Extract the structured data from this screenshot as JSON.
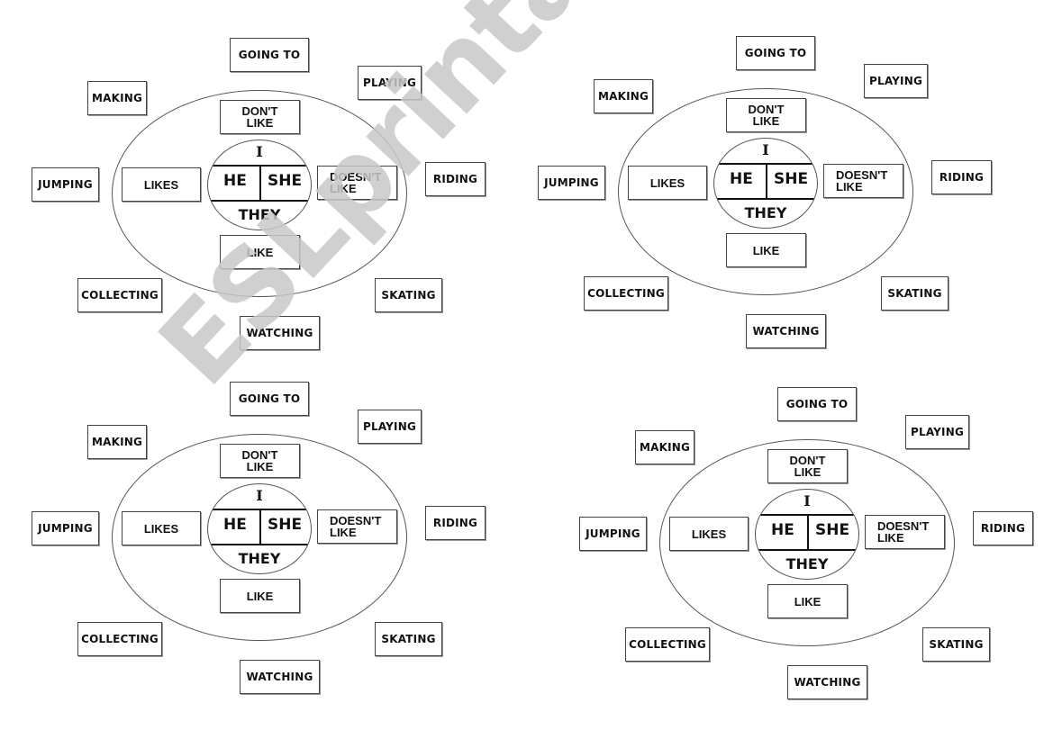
{
  "worksheet": {
    "diagrams": [
      {
        "pronouns": {
          "top": "I",
          "left": "HE",
          "right": "SHE",
          "bottom": "THEY"
        },
        "aux": {
          "dont_like": "DON'T\nLIKE",
          "likes": "LIKES",
          "doesnt_like": "DOESN'T\nLIKE",
          "like": "LIKE"
        },
        "verbs": {
          "going_to": "GOING TO",
          "playing": "PLAYING",
          "making": "MAKING",
          "jumping": "JUMPING",
          "riding": "RIDING",
          "collecting": "COLLECTING",
          "skating": "SKATING",
          "watching": "WATCHING"
        }
      },
      {
        "pronouns": {
          "top": "I",
          "left": "HE",
          "right": "SHE",
          "bottom": "THEY"
        },
        "aux": {
          "dont_like": "DON'T\nLIKE",
          "likes": "LIKES",
          "doesnt_like": "DOESN'T\nLIKE",
          "like": "LIKE"
        },
        "verbs": {
          "going_to": "GOING TO",
          "playing": "PLAYING",
          "making": "MAKING",
          "jumping": "JUMPING",
          "riding": "RIDING",
          "collecting": "COLLECTING",
          "skating": "SKATING",
          "watching": "WATCHING"
        }
      },
      {
        "pronouns": {
          "top": "I",
          "left": "HE",
          "right": "SHE",
          "bottom": "THEY"
        },
        "aux": {
          "dont_like": "DON'T\nLIKE",
          "likes": "LIKES",
          "doesnt_like": "DOESN'T\nLIKE",
          "like": "LIKE"
        },
        "verbs": {
          "going_to": "GOING TO",
          "playing": "PLAYING",
          "making": "MAKING",
          "jumping": "JUMPING",
          "riding": "RIDING",
          "collecting": "COLLECTING",
          "skating": "SKATING",
          "watching": "WATCHING"
        }
      },
      {
        "pronouns": {
          "top": "I",
          "left": "HE",
          "right": "SHE",
          "bottom": "THEY"
        },
        "aux": {
          "dont_like": "DON'T\nLIKE",
          "likes": "LIKES",
          "doesnt_like": "DOESN'T\nLIKE",
          "like": "LIKE"
        },
        "verbs": {
          "going_to": "GOING TO",
          "playing": "PLAYING",
          "making": "MAKING",
          "jumping": "JUMPING",
          "riding": "RIDING",
          "collecting": "COLLECTING",
          "skating": "SKATING",
          "watching": "WATCHING"
        }
      }
    ]
  },
  "watermark": {
    "text": "ESLprintables.com",
    "color": "#c8c8c8"
  },
  "colors": {
    "ink": "#111111",
    "border": "#444444",
    "background": "#ffffff"
  }
}
